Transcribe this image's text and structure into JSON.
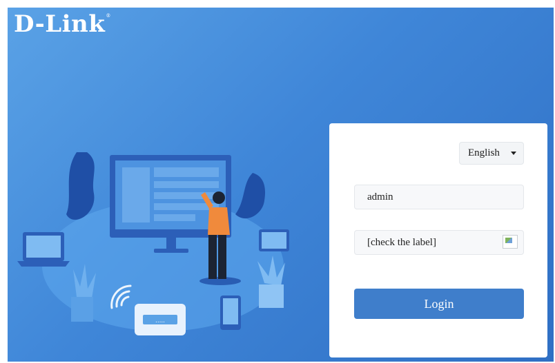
{
  "brand": {
    "logo_text": "D-Link",
    "trademark": "®"
  },
  "login": {
    "language": {
      "selected": "English"
    },
    "username": {
      "value": "admin"
    },
    "password": {
      "value": "[check the label]"
    },
    "submit_label": "Login"
  },
  "illustration": {
    "router_display": "....."
  },
  "colors": {
    "background_start": "#5aa2e6",
    "background_end": "#2f6fc4",
    "button": "#3f7ecb",
    "card": "#ffffff"
  }
}
